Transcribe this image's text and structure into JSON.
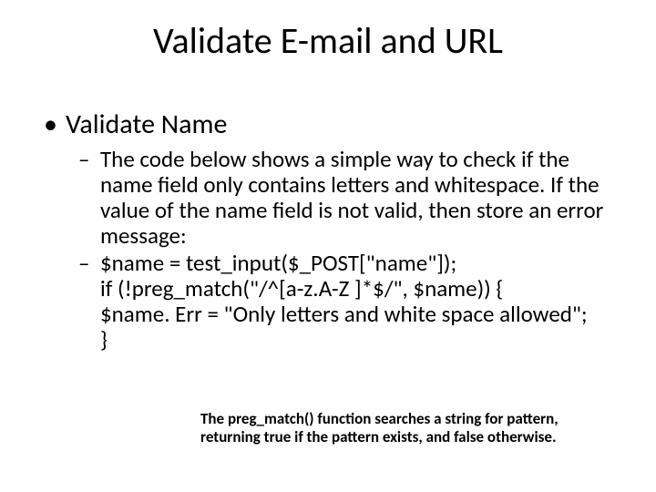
{
  "title": "Validate E-mail and URL",
  "bullets": {
    "lvl1_0": "Validate Name",
    "lvl2_0": "The code below shows a simple way to check if the name field only contains letters and whitespace. If the value of the name field is not valid, then store an error message:",
    "lvl2_1": "$name = test_input($_POST[\"name\"]);\nif (!preg_match(\"/^[a-z.A-Z ]*$/\", $name)) {\n  $name. Err = \"Only letters and white space allowed\";\n}"
  },
  "footnote": "The preg_match() function searches a string for pattern, returning true if the pattern exists, and false otherwise."
}
